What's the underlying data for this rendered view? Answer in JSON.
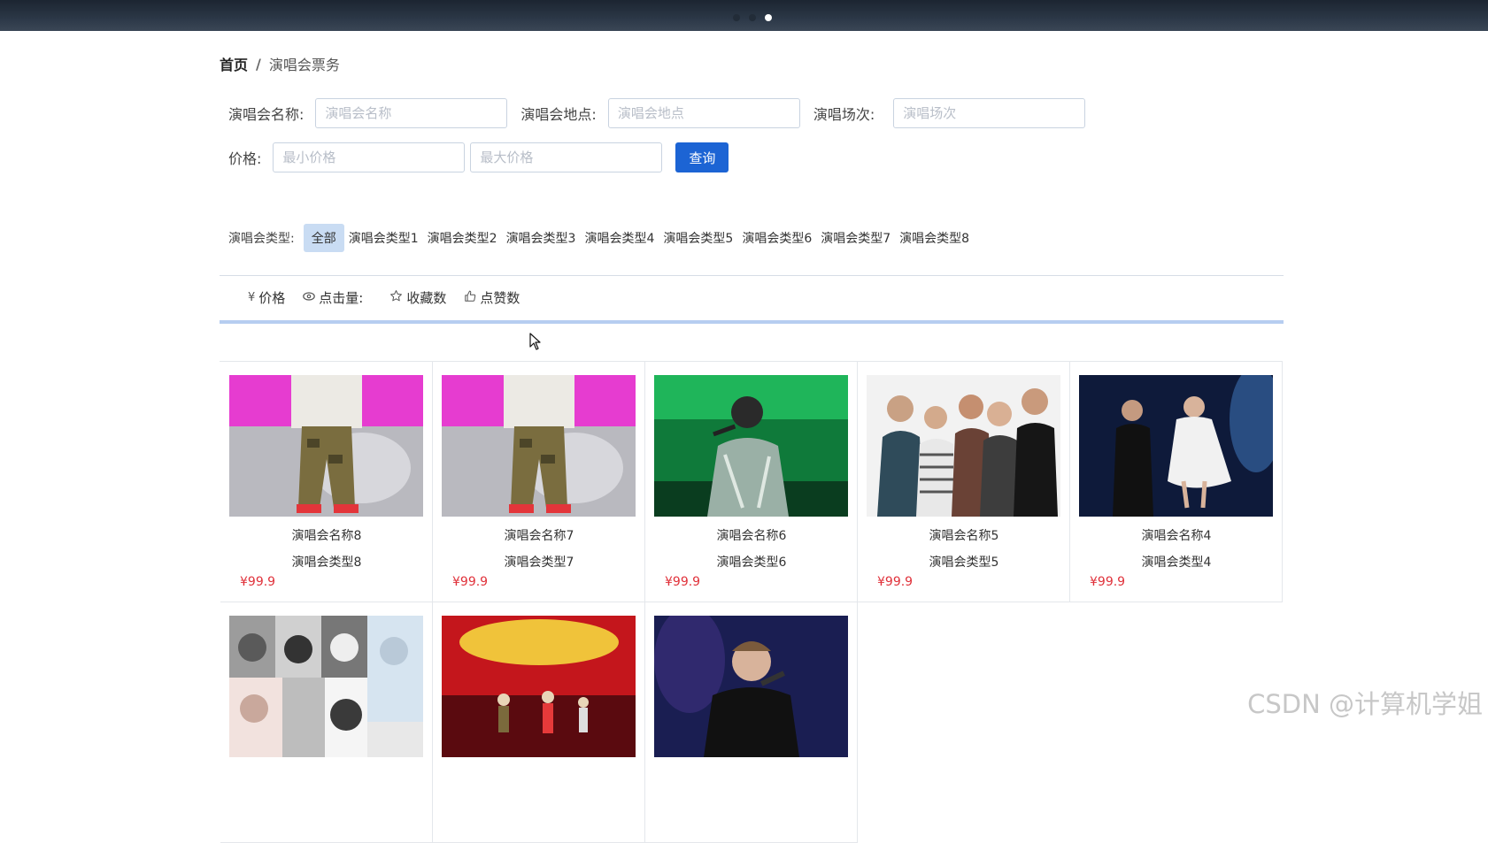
{
  "banner": {
    "slide_count": 3,
    "active_slide": 3
  },
  "breadcrumb": {
    "home": "首页",
    "separator": "/",
    "current": "演唱会票务"
  },
  "search": {
    "name_label": "演唱会名称:",
    "name_placeholder": "演唱会名称",
    "location_label": "演唱会地点:",
    "location_placeholder": "演唱会地点",
    "session_label": "演唱场次:",
    "session_placeholder": "演唱场次",
    "price_label": "价格:",
    "min_price_placeholder": "最小价格",
    "max_price_placeholder": "最大价格",
    "query_button": "查询"
  },
  "types": {
    "label": "演唱会类型:",
    "items": [
      "全部",
      "演唱会类型1",
      "演唱会类型2",
      "演唱会类型3",
      "演唱会类型4",
      "演唱会类型5",
      "演唱会类型6",
      "演唱会类型7",
      "演唱会类型8"
    ],
    "selected": "全部"
  },
  "sort": {
    "price": {
      "icon": "yen-icon",
      "label": "价格"
    },
    "clicks": {
      "icon": "eye-icon",
      "label": "点击量:"
    },
    "favorites": {
      "icon": "star-icon",
      "label": "收藏数"
    },
    "likes": {
      "icon": "thumbs-up-icon",
      "label": "点赞数"
    }
  },
  "products": [
    {
      "name": "演唱会名称8",
      "type": "演唱会类型8",
      "price": "¥99.9",
      "image": "rapper-on-stage"
    },
    {
      "name": "演唱会名称7",
      "type": "演唱会类型7",
      "price": "¥99.9",
      "image": "rapper-on-stage"
    },
    {
      "name": "演唱会名称6",
      "type": "演唱会类型6",
      "price": "¥99.9",
      "image": "singer-green-jacket"
    },
    {
      "name": "演唱会名称5",
      "type": "演唱会类型5",
      "price": "¥99.9",
      "image": "band-group-photo"
    },
    {
      "name": "演唱会名称4",
      "type": "演唱会类型4",
      "price": "¥99.9",
      "image": "duet-on-stage"
    },
    {
      "name": "",
      "type": "",
      "price": "",
      "image": "portrait-collage"
    },
    {
      "name": "",
      "type": "",
      "price": "",
      "image": "red-stage-performance"
    },
    {
      "name": "",
      "type": "",
      "price": "",
      "image": "singer-black-jacket"
    }
  ],
  "watermark": "CSDN @计算机学姐",
  "colors": {
    "primary": "#1c64d4",
    "price": "#e0313a",
    "active_type_bg": "#c9dcf3",
    "sort_underline": "#b6cdf0"
  }
}
